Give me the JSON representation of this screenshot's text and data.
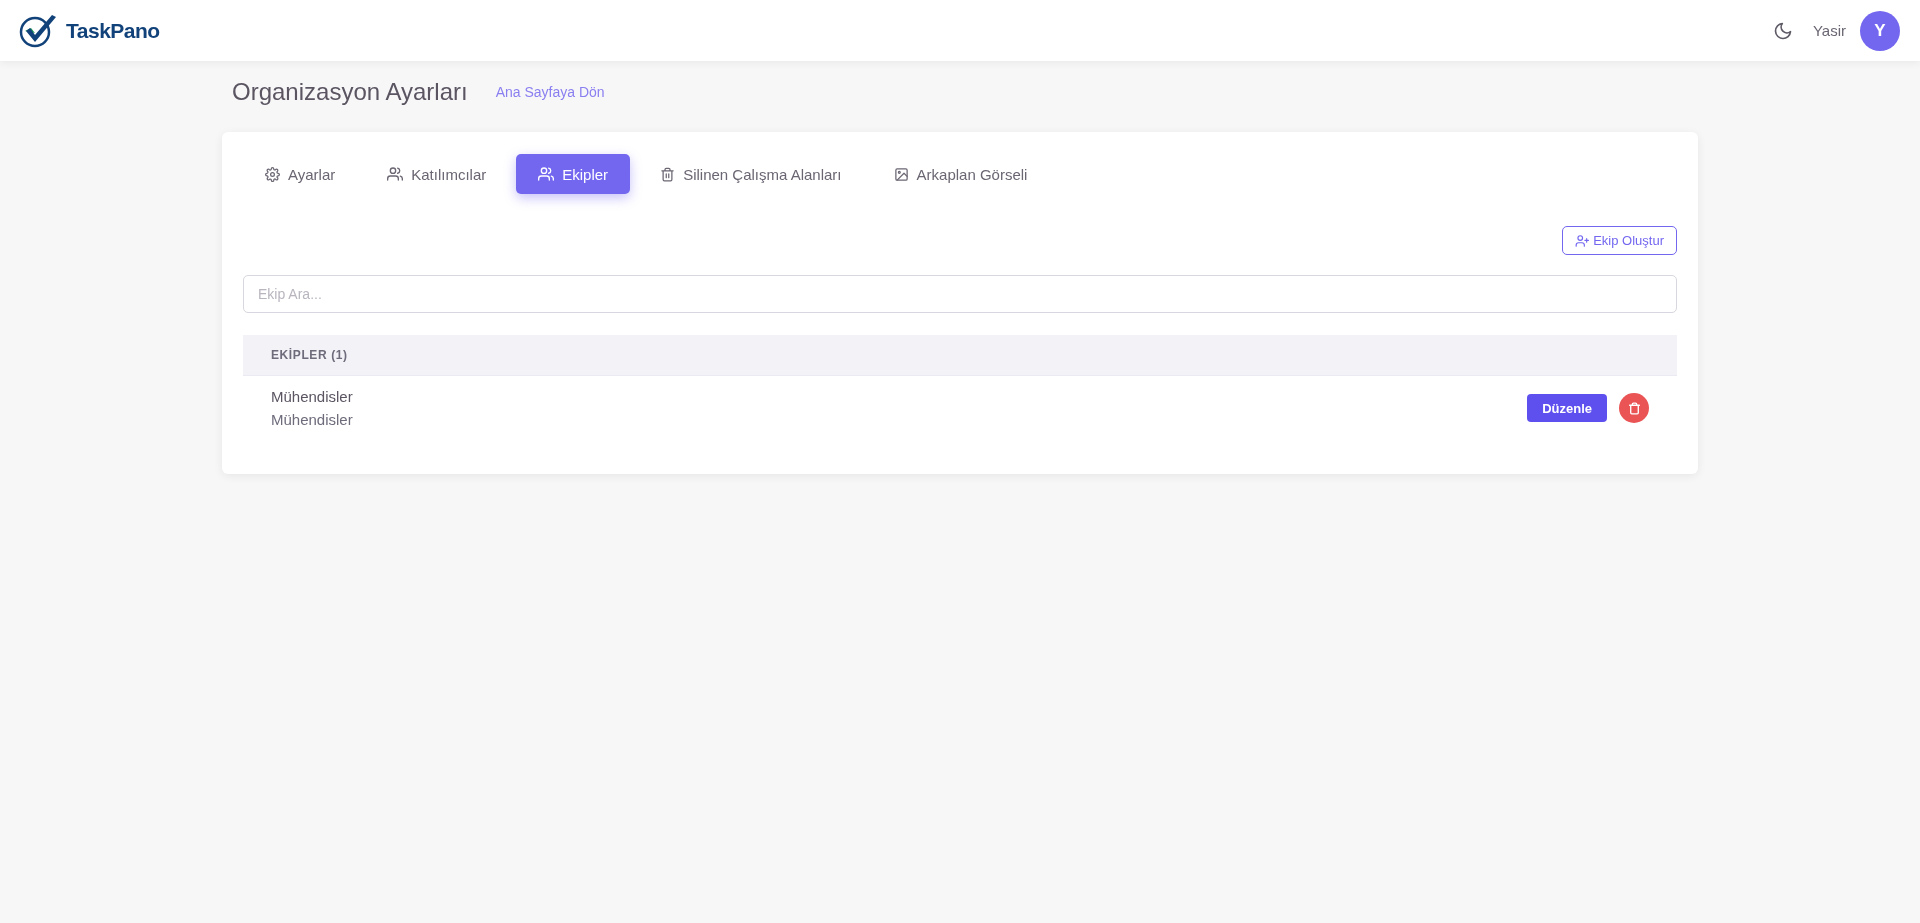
{
  "header": {
    "logo": "TaskPano",
    "user_name": "Yasir",
    "avatar_initial": "Y"
  },
  "page": {
    "title": "Organizasyon Ayarları",
    "back_link": "Ana Sayfaya Dön"
  },
  "tabs": [
    {
      "label": "Ayarlar",
      "kind": "gear",
      "selected": false
    },
    {
      "label": "Katılımcılar",
      "kind": "users",
      "selected": false
    },
    {
      "label": "Ekipler",
      "kind": "users",
      "selected": true
    },
    {
      "label": "Silinen Çalışma Alanları",
      "kind": "trash",
      "selected": false
    },
    {
      "label": "Arkaplan Görseli",
      "kind": "image",
      "selected": false
    }
  ],
  "create_button": "Ekip Oluştur",
  "search": {
    "placeholder": "Ekip Ara..."
  },
  "teams": {
    "heading": "EKİPLER (1)",
    "rows": [
      {
        "name": "Mühendisler",
        "description": "Mühendisler",
        "edit_button": "Düzenle"
      }
    ]
  }
}
